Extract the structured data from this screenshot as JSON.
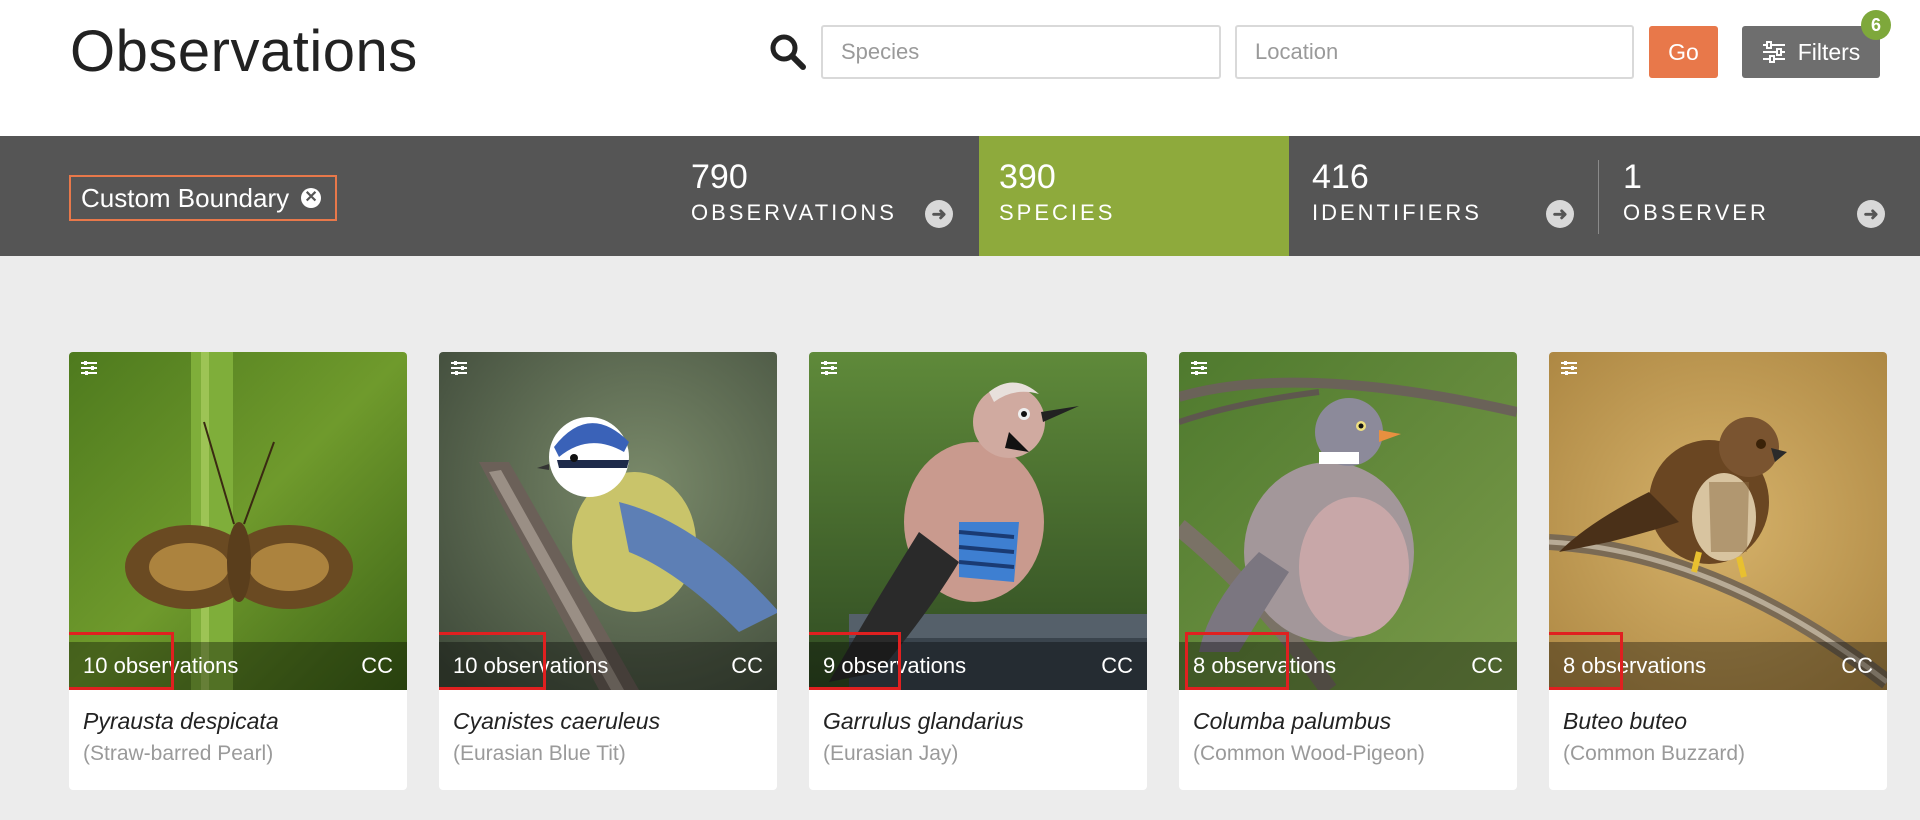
{
  "header": {
    "title": "Observations",
    "search_icon": "search-icon",
    "species_placeholder": "Species",
    "location_placeholder": "Location",
    "go_label": "Go",
    "filters_label": "Filters",
    "filters_icon": "sliders-icon",
    "filters_count": "6"
  },
  "stats": {
    "boundary_label": "Custom Boundary",
    "boundary_close_glyph": "✕",
    "tabs": [
      {
        "count": "790",
        "label": "OBSERVATIONS",
        "active": false
      },
      {
        "count": "390",
        "label": "SPECIES",
        "active": true
      },
      {
        "count": "416",
        "label": "IDENTIFIERS",
        "active": false
      },
      {
        "count": "1",
        "label": "OBSERVER",
        "active": false
      }
    ],
    "arrow_glyph": "➜"
  },
  "cards": [
    {
      "observations": "10 observations",
      "license": "CC",
      "scientific": "Pyrausta despicata",
      "common": "(Straw-barred Pearl)",
      "photo": "moth-on-grass"
    },
    {
      "observations": "10 observations",
      "license": "CC",
      "scientific": "Cyanistes caeruleus",
      "common": "(Eurasian Blue Tit)",
      "photo": "blue-tit-on-branch"
    },
    {
      "observations": "9 observations",
      "license": "CC",
      "scientific": "Garrulus glandarius",
      "common": "(Eurasian Jay)",
      "photo": "jay-on-fence"
    },
    {
      "observations": "8 observations",
      "license": "CC",
      "scientific": "Columba palumbus",
      "common": "(Common Wood-Pigeon)",
      "photo": "pigeon-on-branch"
    },
    {
      "observations": "8 observations",
      "license": "CC",
      "scientific": "Buteo buteo",
      "common": "(Common Buzzard)",
      "photo": "buzzard-on-branch"
    }
  ],
  "colors": {
    "accent_orange": "#e8784a",
    "active_green": "#8eaa3c",
    "bar_gray": "#555555",
    "highlight_red": "#e02020"
  }
}
